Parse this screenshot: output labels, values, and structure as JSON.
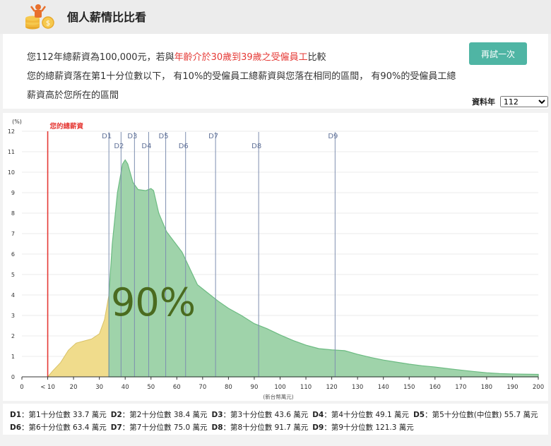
{
  "header": {
    "title": "個人薪情比比看",
    "logo_icon": "coins-money-person-icon"
  },
  "summary": {
    "line1_prefix": "您112年總薪資為100,000元，若與",
    "line1_highlight": "年齡介於30歲到39歲之受僱員工",
    "line1_suffix": "比較",
    "line2": "您的總薪資落在第1十分位數以下， 有10%的受僱員工總薪資與您落在相同的區間， 有90%的受僱員工總",
    "line3": "薪資高於您所在的區間",
    "retry_label": "再試一次",
    "year_label": "資料年",
    "year_value": "112",
    "highlight_color": "#e53935"
  },
  "chart_data": {
    "type": "area",
    "title": "",
    "ylabel": "(%)",
    "xlabel": "(新台幣萬元)",
    "xlim": [
      0,
      200
    ],
    "ylim": [
      0,
      12
    ],
    "x_ticks": [
      0,
      10,
      20,
      30,
      40,
      50,
      60,
      70,
      80,
      90,
      100,
      110,
      120,
      130,
      140,
      150,
      160,
      170,
      180,
      190,
      200
    ],
    "x_tick_labels": [
      "0",
      "< 10",
      "20",
      "30",
      "40",
      "50",
      "60",
      "70",
      "80",
      "90",
      "100",
      "110",
      "120",
      "130",
      "140",
      "150",
      "160",
      "170",
      "180",
      "190",
      "200"
    ],
    "y_ticks": [
      0,
      1,
      2,
      3,
      4,
      5,
      6,
      7,
      8,
      9,
      10,
      11,
      12
    ],
    "user_marker": {
      "label": "您的總薪資",
      "x": 10,
      "color": "#e53935"
    },
    "split_x": 33.7,
    "pct_label": "90%",
    "below_color": "#f0dc8c",
    "above_color": "#9fd3aa",
    "points": [
      [
        10,
        0
      ],
      [
        12,
        0.3
      ],
      [
        15,
        0.7
      ],
      [
        18,
        1.3
      ],
      [
        21,
        1.65
      ],
      [
        24,
        1.75
      ],
      [
        27,
        1.85
      ],
      [
        30,
        2.1
      ],
      [
        32,
        2.8
      ],
      [
        33.7,
        4.0
      ],
      [
        35,
        6.5
      ],
      [
        37,
        9.0
      ],
      [
        39,
        10.4
      ],
      [
        40,
        10.6
      ],
      [
        41,
        10.4
      ],
      [
        43,
        9.5
      ],
      [
        45,
        9.15
      ],
      [
        48,
        9.1
      ],
      [
        50,
        9.2
      ],
      [
        51,
        9.1
      ],
      [
        53,
        8.0
      ],
      [
        56,
        7.1
      ],
      [
        59,
        6.6
      ],
      [
        62,
        6.1
      ],
      [
        65,
        5.3
      ],
      [
        68,
        4.5
      ],
      [
        72,
        4.1
      ],
      [
        76,
        3.7
      ],
      [
        80,
        3.35
      ],
      [
        85,
        3.0
      ],
      [
        90,
        2.6
      ],
      [
        95,
        2.35
      ],
      [
        100,
        2.05
      ],
      [
        105,
        1.78
      ],
      [
        110,
        1.55
      ],
      [
        115,
        1.38
      ],
      [
        120,
        1.32
      ],
      [
        125,
        1.28
      ],
      [
        130,
        1.1
      ],
      [
        135,
        0.95
      ],
      [
        140,
        0.82
      ],
      [
        145,
        0.72
      ],
      [
        150,
        0.62
      ],
      [
        155,
        0.54
      ],
      [
        160,
        0.48
      ],
      [
        165,
        0.4
      ],
      [
        170,
        0.33
      ],
      [
        175,
        0.26
      ],
      [
        180,
        0.2
      ],
      [
        185,
        0.16
      ],
      [
        190,
        0.14
      ],
      [
        195,
        0.13
      ],
      [
        200,
        0.12
      ]
    ],
    "deciles": [
      {
        "label": "D1",
        "x": 33.7,
        "pos": "top"
      },
      {
        "label": "D2",
        "x": 38.4,
        "pos": "low"
      },
      {
        "label": "D3",
        "x": 43.6,
        "pos": "top"
      },
      {
        "label": "D4",
        "x": 49.1,
        "pos": "low"
      },
      {
        "label": "D5",
        "x": 55.7,
        "pos": "top"
      },
      {
        "label": "D6",
        "x": 63.4,
        "pos": "low"
      },
      {
        "label": "D7",
        "x": 75.0,
        "pos": "top"
      },
      {
        "label": "D8",
        "x": 91.7,
        "pos": "low"
      },
      {
        "label": "D9",
        "x": 121.3,
        "pos": "top"
      }
    ]
  },
  "legend": {
    "row1": [
      {
        "key": "D1",
        "text": "：第1十分位數 33.7 萬元"
      },
      {
        "key": "D2",
        "text": "：第2十分位數 38.4 萬元"
      },
      {
        "key": "D3",
        "text": "：第3十分位數 43.6 萬元"
      },
      {
        "key": "D4",
        "text": "：第4十分位數 49.1 萬元"
      },
      {
        "key": "D5",
        "text": "：第5十分位數(中位數) 55.7 萬元"
      }
    ],
    "row2": [
      {
        "key": "D6",
        "text": "：第6十分位數 63.4 萬元"
      },
      {
        "key": "D7",
        "text": "：第7十分位數 75.0 萬元"
      },
      {
        "key": "D8",
        "text": "：第8十分位數 91.7 萬元"
      },
      {
        "key": "D9",
        "text": "：第9十分位數 121.3 萬元"
      }
    ]
  }
}
